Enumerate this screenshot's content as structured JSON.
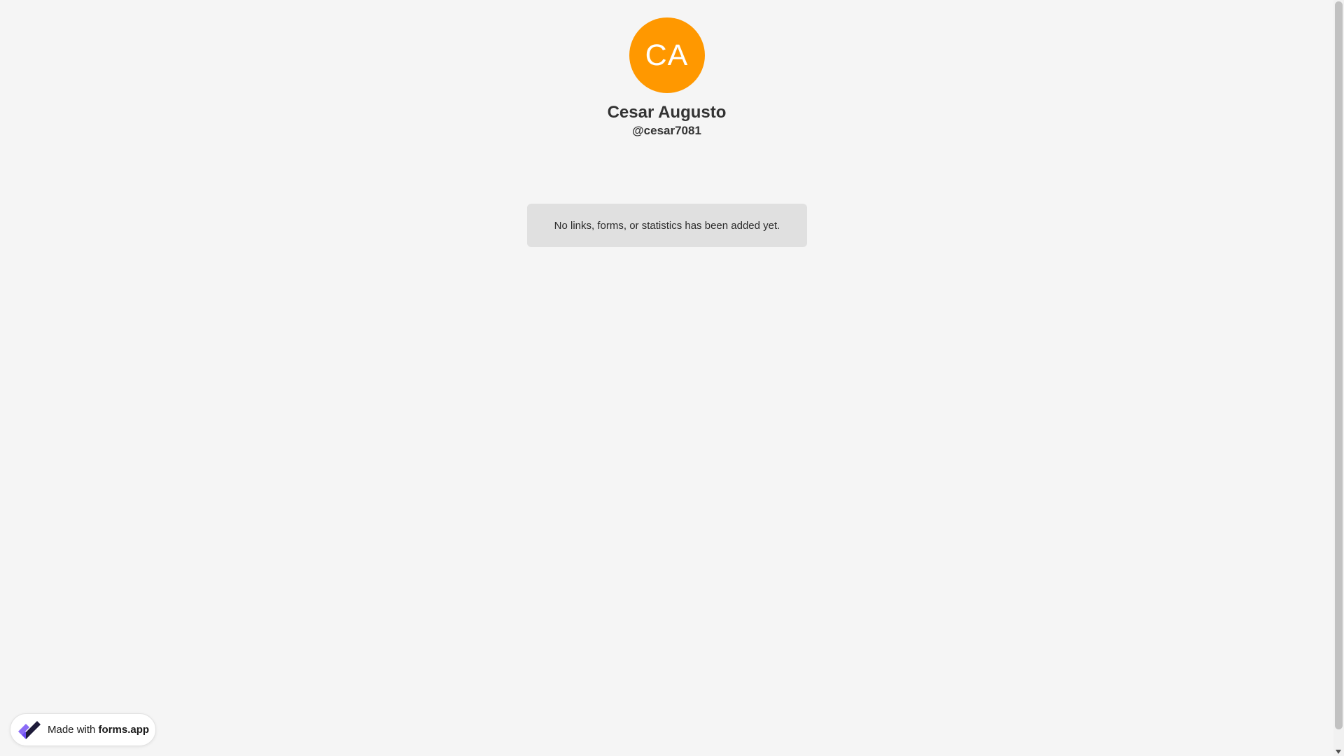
{
  "profile": {
    "initials": "CA",
    "name": "Cesar Augusto",
    "handle": "@cesar7081",
    "avatar_color": "#ff9800"
  },
  "content": {
    "empty_message": "No links, forms, or statistics has been added yet."
  },
  "badge": {
    "prefix": "Made with ",
    "brand": "forms.app",
    "icon": "forms-app-logo-icon"
  },
  "colors": {
    "background": "#f5f5f5",
    "empty_box": "#e0e0e0",
    "logo_purple": "#6c4df2",
    "logo_dark": "#1e1b3a"
  }
}
